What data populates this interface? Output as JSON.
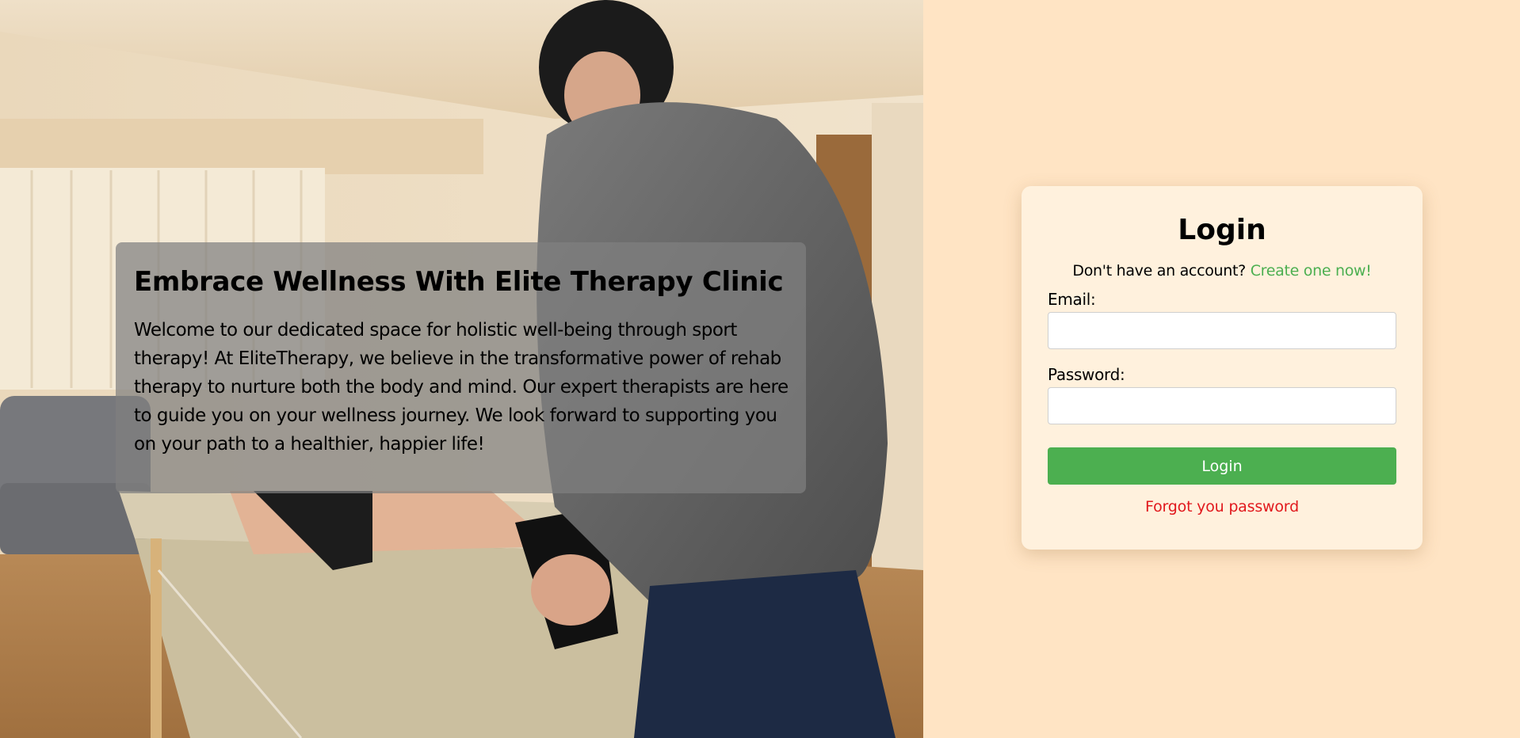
{
  "hero": {
    "title": "Embrace Wellness With Elite Therapy Clinic",
    "description": "Welcome to our dedicated space for holistic well-being through sport therapy! At EliteTherapy, we believe in the transformative power of rehab therapy to nurture both the body and mind. Our expert therapists are here to guide you on your wellness journey. We look forward to supporting you on your path to a healthier, happier life!"
  },
  "login": {
    "title": "Login",
    "signup_prompt": "Don't have an account?",
    "signup_link": "Create one now!",
    "email_label": "Email:",
    "email_value": "",
    "password_label": "Password:",
    "password_value": "",
    "submit_label": "Login",
    "forgot_link": "Forgot you password"
  },
  "colors": {
    "side_background": "#ffe4c4",
    "card_background": "#fff1dd",
    "accent_green": "#4caf50",
    "link_red": "#e1191d",
    "hero_overlay": "rgba(128,128,128,0.72)"
  }
}
